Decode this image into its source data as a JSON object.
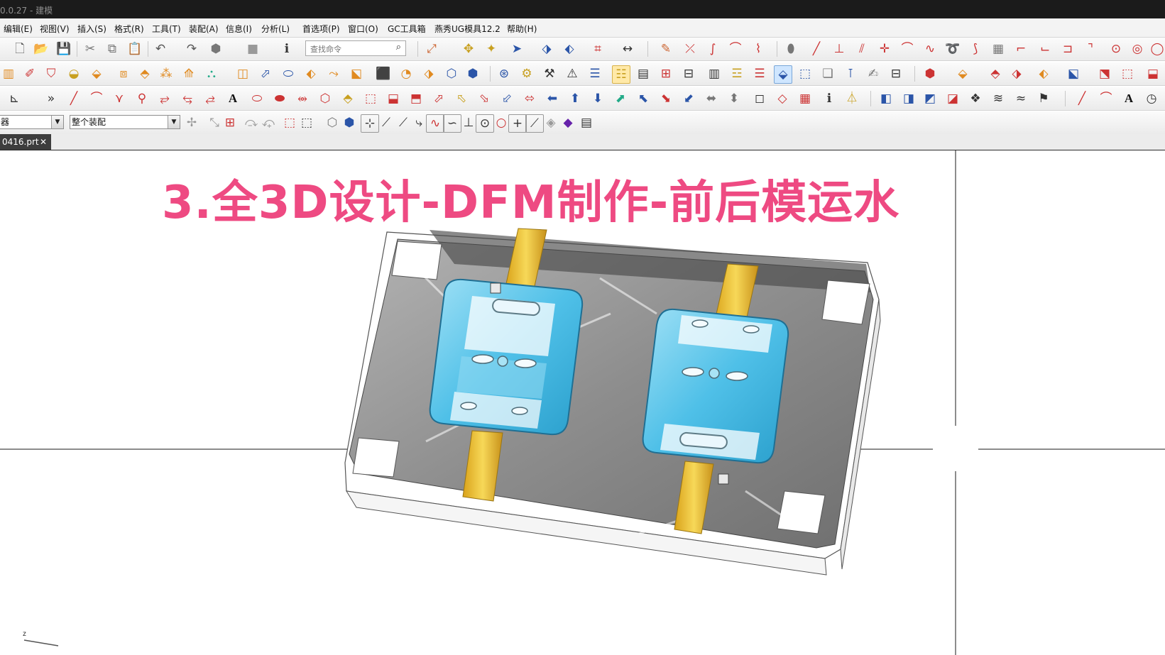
{
  "window": {
    "title": "0.0.27 - 建模"
  },
  "menu": [
    "编辑(E)",
    "视图(V)",
    "插入(S)",
    "格式(R)",
    "工具(T)",
    "装配(A)",
    "信息(I)",
    "分析(L)",
    "首选项(P)",
    "窗口(O)",
    "GC工具箱",
    "燕秀UG模具12.2",
    "帮助(H)"
  ],
  "toolbar": {
    "search_placeholder": "查找命令"
  },
  "selection_bar": {
    "filter_value": "器",
    "scope_value": "整个装配"
  },
  "tab": {
    "filename": "0416.prt",
    "close": "✕"
  },
  "overlay": {
    "title": "3.全3D设计-DFM制作-前后模运水"
  },
  "colors": {
    "title_pink": "#ee4a82",
    "part_cyan": "#5cc8ea",
    "gate_yellow": "#f2c531",
    "mold_gray": "#8e8e8e"
  }
}
